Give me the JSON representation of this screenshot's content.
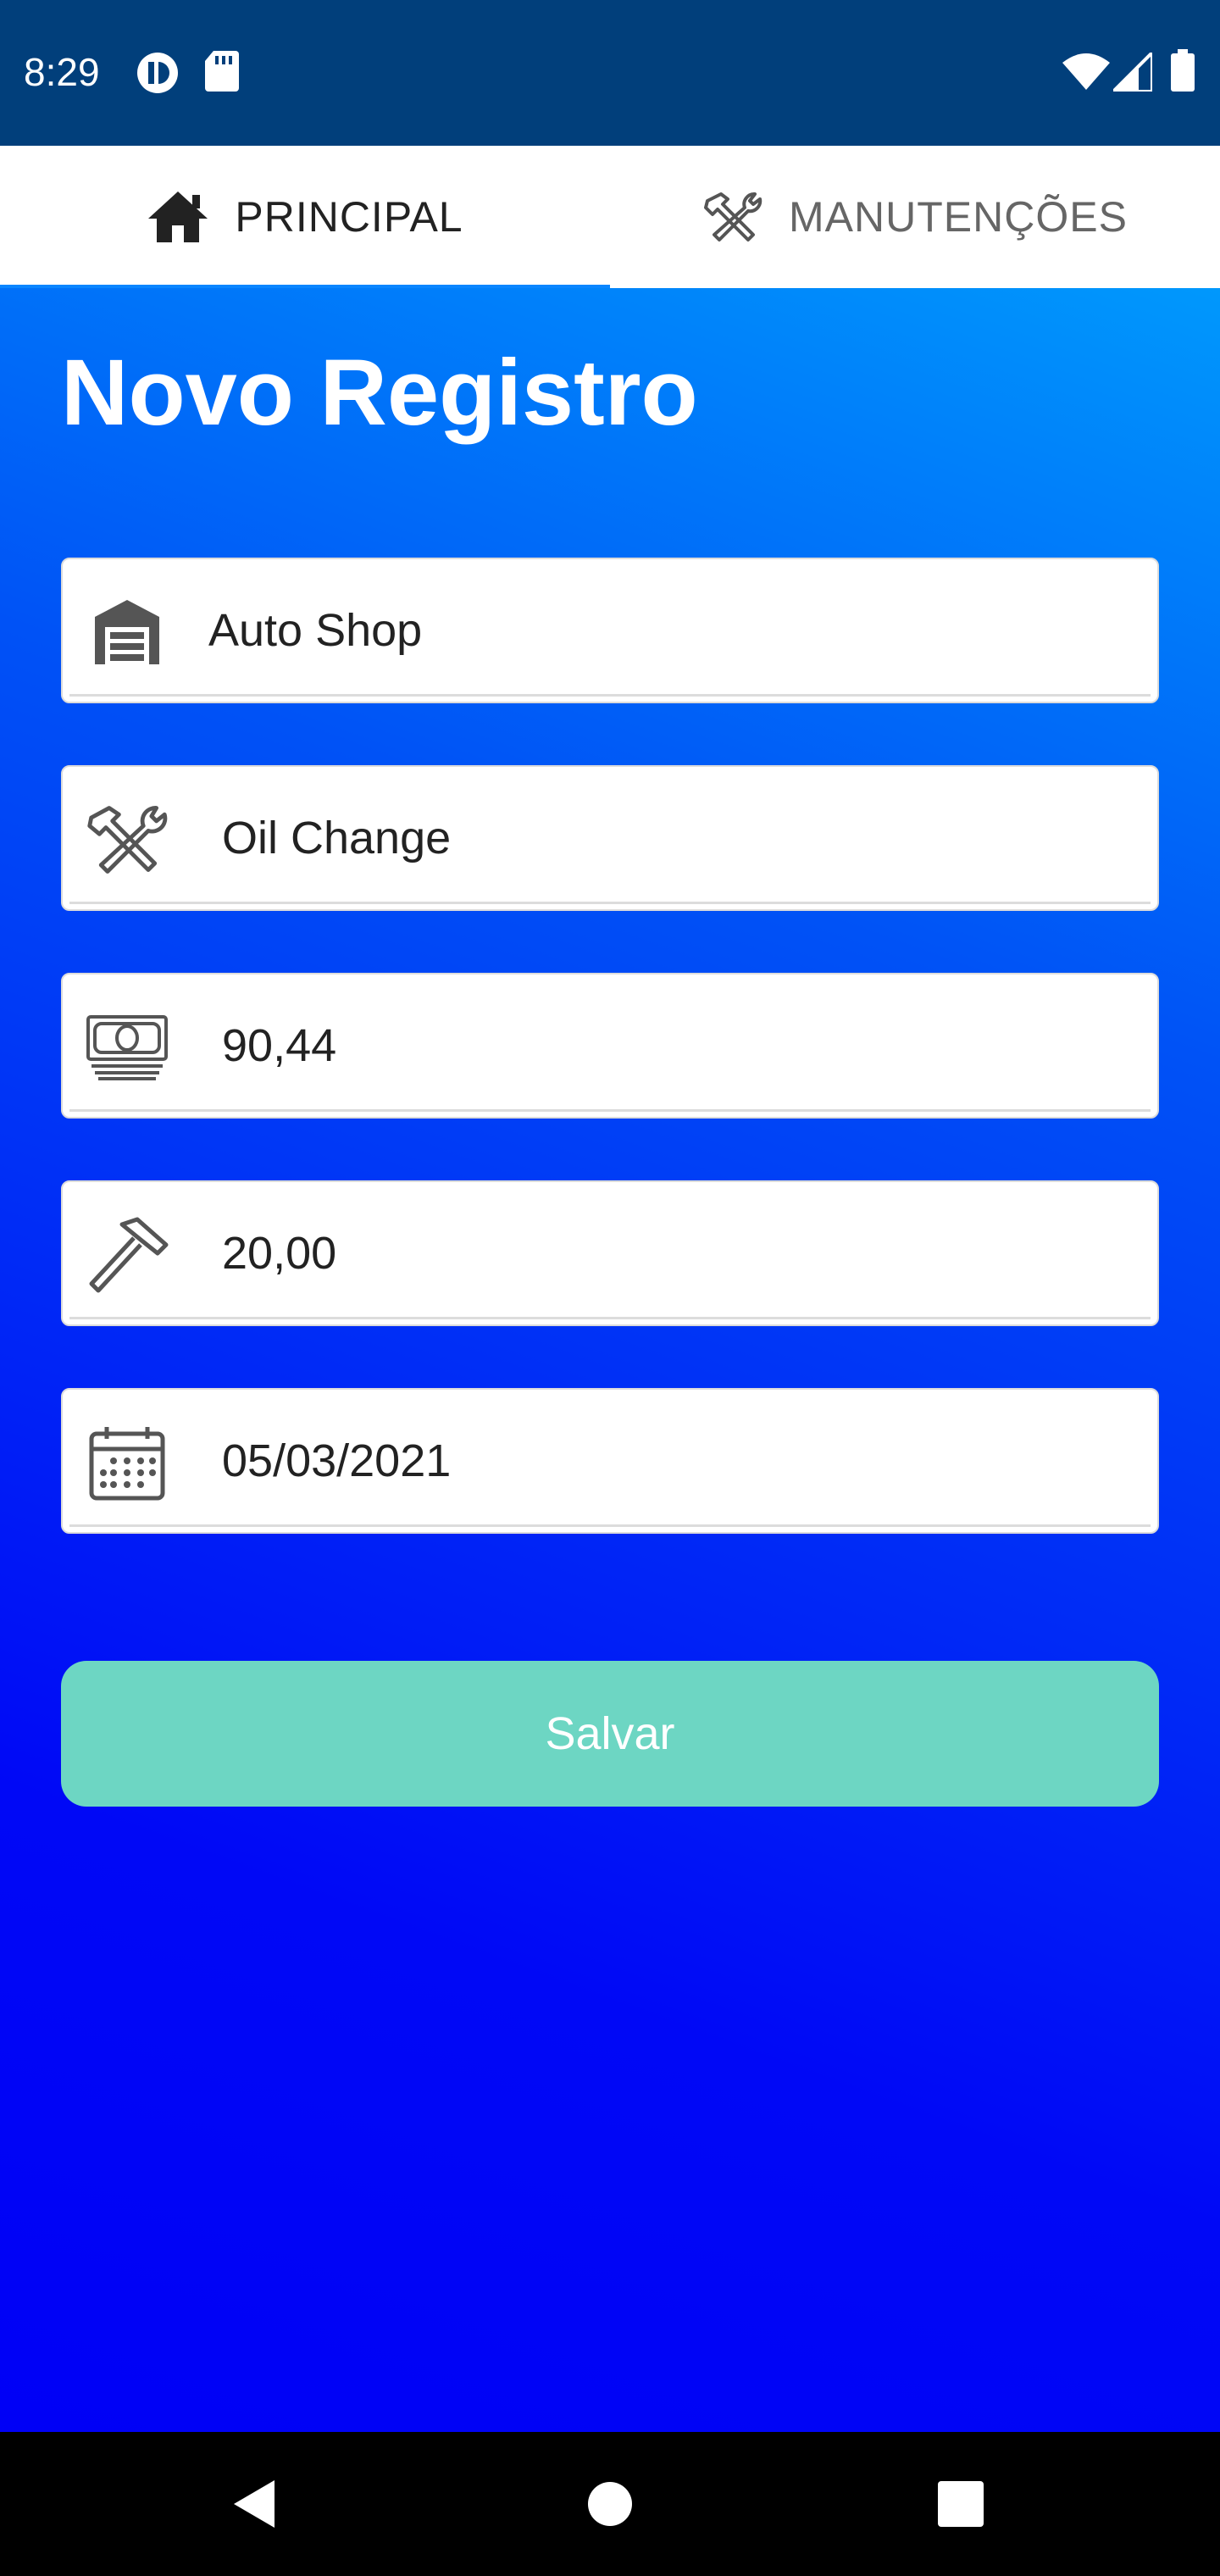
{
  "status_bar": {
    "time": "8:29",
    "icons": [
      "notification-icon",
      "sd-card-icon",
      "wifi-icon",
      "signal-icon",
      "battery-icon"
    ]
  },
  "tabs": [
    {
      "label": "PRINCIPAL",
      "icon": "home-icon",
      "active": true
    },
    {
      "label": "MANUTENÇÕES",
      "icon": "tools-icon",
      "active": false
    }
  ],
  "main": {
    "title": "Novo Registro",
    "fields": [
      {
        "icon": "garage-icon",
        "value": "Auto Shop"
      },
      {
        "icon": "tools-icon",
        "value": "Oil Change"
      },
      {
        "icon": "money-icon",
        "value": "90,44"
      },
      {
        "icon": "hammer-icon",
        "value": "20,00"
      },
      {
        "icon": "calendar-icon",
        "value": "05/03/2021"
      }
    ],
    "save_label": "Salvar"
  },
  "colors": {
    "status_bar": "#013f7b",
    "accent": "#0a86ff",
    "save_button": "#6dd6c3",
    "background_top": "#0098fc",
    "background_bottom": "#0000f6"
  },
  "nav": [
    "back-icon",
    "home-circle-icon",
    "recents-icon"
  ]
}
